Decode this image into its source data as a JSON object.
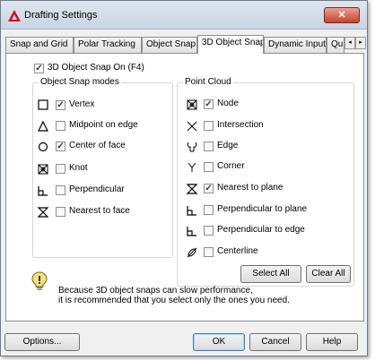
{
  "window": {
    "title": "Drafting Settings",
    "close_glyph": "✕"
  },
  "tabs": [
    {
      "label": "Snap and Grid"
    },
    {
      "label": "Polar Tracking"
    },
    {
      "label": "Object Snap"
    },
    {
      "label": "3D Object Snap"
    },
    {
      "label": "Dynamic Input"
    },
    {
      "label": "Quic"
    }
  ],
  "active_tab": "3D Object Snap",
  "tab_scroll": {
    "left": "◂",
    "right": "▸"
  },
  "snap_toggle": {
    "label": "3D Object Snap On (F4)",
    "checked": true
  },
  "object_snap_modes": {
    "title": "Object Snap modes",
    "items": [
      {
        "label": "Vertex",
        "checked": true,
        "icon": "vertex-square-icon"
      },
      {
        "label": "Midpoint on edge",
        "checked": false,
        "icon": "midpoint-triangle-icon"
      },
      {
        "label": "Center of face",
        "checked": true,
        "icon": "center-circle-icon"
      },
      {
        "label": "Knot",
        "checked": false,
        "icon": "knot-icon"
      },
      {
        "label": "Perpendicular",
        "checked": false,
        "icon": "perpendicular-icon"
      },
      {
        "label": "Nearest to face",
        "checked": false,
        "icon": "nearest-hourglass-icon"
      }
    ]
  },
  "point_cloud": {
    "title": "Point Cloud",
    "items": [
      {
        "label": "Node",
        "checked": true,
        "icon": "node-icon"
      },
      {
        "label": "Intersection",
        "checked": false,
        "icon": "intersection-x-icon"
      },
      {
        "label": "Edge",
        "checked": false,
        "icon": "edge-icon"
      },
      {
        "label": "Corner",
        "checked": false,
        "icon": "corner-y-icon"
      },
      {
        "label": "Nearest to plane",
        "checked": true,
        "icon": "nearest-hourglass-icon"
      },
      {
        "label": "Perpendicular to plane",
        "checked": false,
        "icon": "perpendicular-icon"
      },
      {
        "label": "Perpendicular to edge",
        "checked": false,
        "icon": "perpendicular-icon"
      },
      {
        "label": "Centerline",
        "checked": false,
        "icon": "centerline-icon"
      }
    ]
  },
  "buttons": {
    "select_all": "Select All",
    "clear_all": "Clear All",
    "options": "Options...",
    "ok": "OK",
    "cancel": "Cancel",
    "help": "Help"
  },
  "message": {
    "line1": "Because 3D object snaps can slow performance,",
    "line2": "it is recommended that you select only the ones you need."
  },
  "check_glyph": "✓",
  "colors": {
    "accent": "#2e3d57",
    "close": "#c5432c",
    "app_icon": "#c8102e"
  }
}
